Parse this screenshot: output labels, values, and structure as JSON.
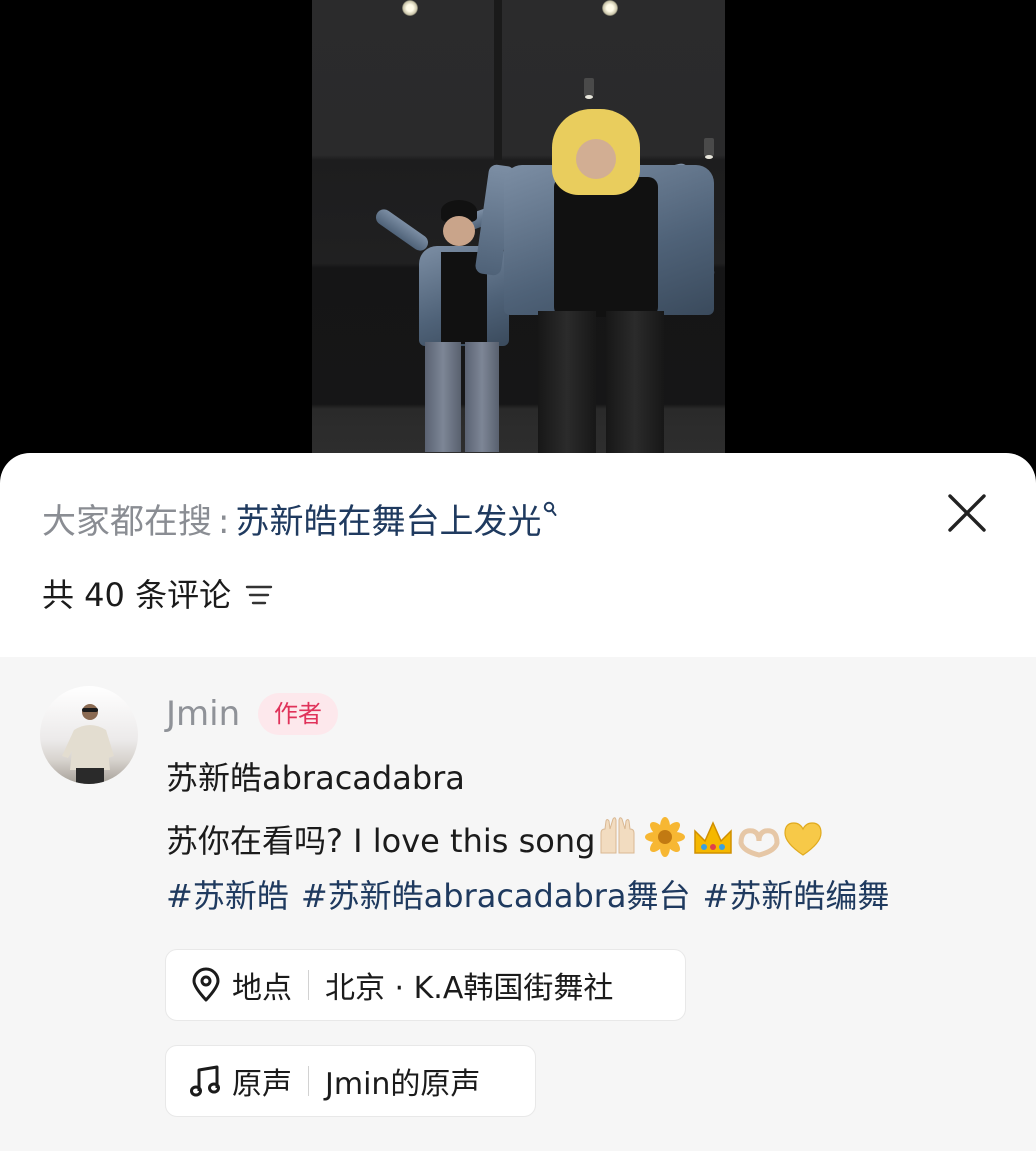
{
  "search_hint": {
    "prefix": "大家都在搜",
    "colon": ":",
    "term": "苏新皓在舞台上发光"
  },
  "comments_header": {
    "count_label": "共 40 条评论"
  },
  "comment": {
    "username": "Jmin",
    "badge": "作者",
    "line1": "苏新皓abracadabra",
    "line2_text": "苏你在看吗? I love this song",
    "line2_emojis": [
      "raising-hands-icon",
      "blossom-icon",
      "crown-icon",
      "heart-hands-icon",
      "yellow-heart-icon"
    ],
    "hashtags": [
      "#苏新皓",
      "#苏新皓abracadabra舞台",
      "#苏新皓编舞"
    ]
  },
  "location_pill": {
    "label": "地点",
    "value": "北京 · K.A韩国街舞社"
  },
  "sound_pill": {
    "label": "原声",
    "value": "Jmin的原声"
  },
  "colors": {
    "accent_link": "#1f3a5f",
    "badge_text": "#e0325a",
    "badge_bg": "#fde8ec",
    "muted_text": "#8a8d93",
    "card_bg": "#f6f6f6"
  }
}
